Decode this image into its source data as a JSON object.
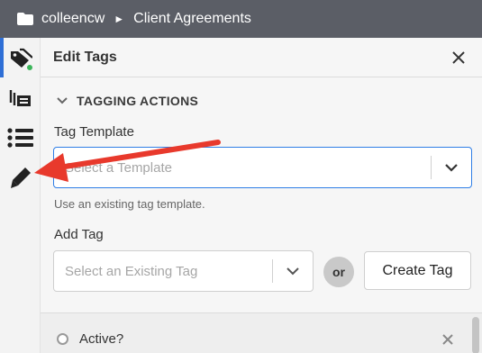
{
  "breadcrumb": {
    "parent": "colleencw",
    "separator": "►",
    "current": "Client Agreements"
  },
  "sidebar": {
    "icons": [
      "tag-icon",
      "stacked-cards-icon",
      "list-icon",
      "pen-icon"
    ]
  },
  "panel": {
    "title": "Edit Tags",
    "close_icon": "close-icon"
  },
  "tagging": {
    "section_title": "TAGGING ACTIONS",
    "template_label": "Tag Template",
    "template_placeholder": "Select a Template",
    "template_hint": "Use an existing tag template.",
    "add_label": "Add Tag",
    "existing_placeholder": "Select an Existing Tag",
    "or_text": "or",
    "create_button": "Create Tag"
  },
  "tags": [
    {
      "label": "Active?"
    }
  ],
  "colors": {
    "topbar": "#5b5e66",
    "accent": "#2f6fd6",
    "status": "#3cb55a",
    "annotation_arrow": "#e8392c"
  }
}
